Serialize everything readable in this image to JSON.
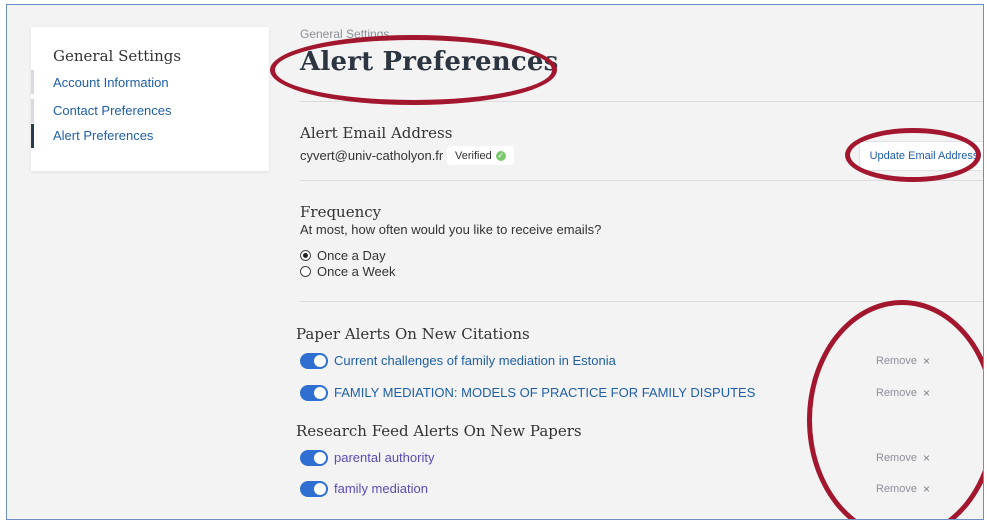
{
  "sidebar": {
    "title": "General Settings",
    "items": [
      {
        "label": "Account Information"
      },
      {
        "label": "Contact Preferences"
      },
      {
        "label": "Alert Preferences"
      }
    ]
  },
  "header": {
    "breadcrumb": "General Settings",
    "title": "Alert Preferences"
  },
  "email_section": {
    "heading": "Alert Email Address",
    "email": "cyvert@univ-catholyon.fr",
    "badge": "Verified",
    "update_button": "Update Email Address"
  },
  "frequency": {
    "heading": "Frequency",
    "question": "At most, how often would you like to receive emails?",
    "options": [
      {
        "label": "Once a Day",
        "selected": true
      },
      {
        "label": "Once a Week",
        "selected": false
      }
    ]
  },
  "paper_alerts": {
    "heading": "Paper Alerts On New Citations",
    "items": [
      {
        "label": "Current challenges of family mediation in Estonia",
        "enabled": true,
        "remove": "Remove"
      },
      {
        "label": "FAMILY MEDIATION: MODELS OF PRACTICE FOR FAMILY DISPUTES",
        "enabled": true,
        "remove": "Remove"
      }
    ]
  },
  "feed_alerts": {
    "heading": "Research Feed Alerts On New Papers",
    "items": [
      {
        "label": "parental authority",
        "enabled": true,
        "remove": "Remove"
      },
      {
        "label": "family mediation",
        "enabled": true,
        "remove": "Remove"
      }
    ]
  },
  "icons": {
    "close": "×",
    "check": "✓"
  },
  "colors": {
    "link": "#1f5fa8",
    "toggle_on": "#2f6fd1",
    "annotation": "#a3172e"
  }
}
